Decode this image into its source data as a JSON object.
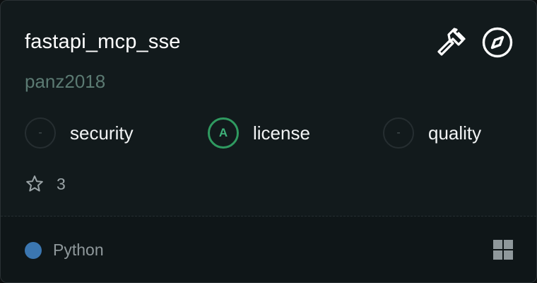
{
  "repo": {
    "name": "fastapi_mcp_sse",
    "owner": "panz2018"
  },
  "actions": {
    "hammer_icon": "hammer-icon",
    "compass_icon": "compass-icon"
  },
  "scores": [
    {
      "grade": "-",
      "label": "security"
    },
    {
      "grade": "A",
      "label": "license"
    },
    {
      "grade": "-",
      "label": "quality"
    }
  ],
  "stars": {
    "count": "3",
    "icon": "star-icon"
  },
  "footer": {
    "language": "Python",
    "language_color": "#3b76b0",
    "grid_icon": "grid-icon"
  },
  "colors": {
    "card_bg": "#121a1c",
    "accent_green": "#2f9a60",
    "owner_text": "#5b7a72"
  }
}
